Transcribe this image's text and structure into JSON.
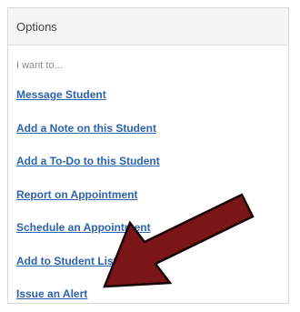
{
  "options_panel": {
    "title": "Options",
    "prompt": "I want to...",
    "items": [
      {
        "label": "Message Student"
      },
      {
        "label": "Add a Note on this Student"
      },
      {
        "label": "Add a To-Do to this Student"
      },
      {
        "label": "Report on Appointment"
      },
      {
        "label": "Schedule an Appointment"
      },
      {
        "label": "Add to Student List"
      },
      {
        "label": "Issue an Alert"
      }
    ]
  },
  "annotation": {
    "arrow_color": "#7a1518",
    "arrow_outline": "#1a0505",
    "icon": "arrow-pointer-icon"
  },
  "colors": {
    "link": "#2b63b0",
    "header_bg": "#f5f5f5",
    "border": "#d9d9d9"
  }
}
